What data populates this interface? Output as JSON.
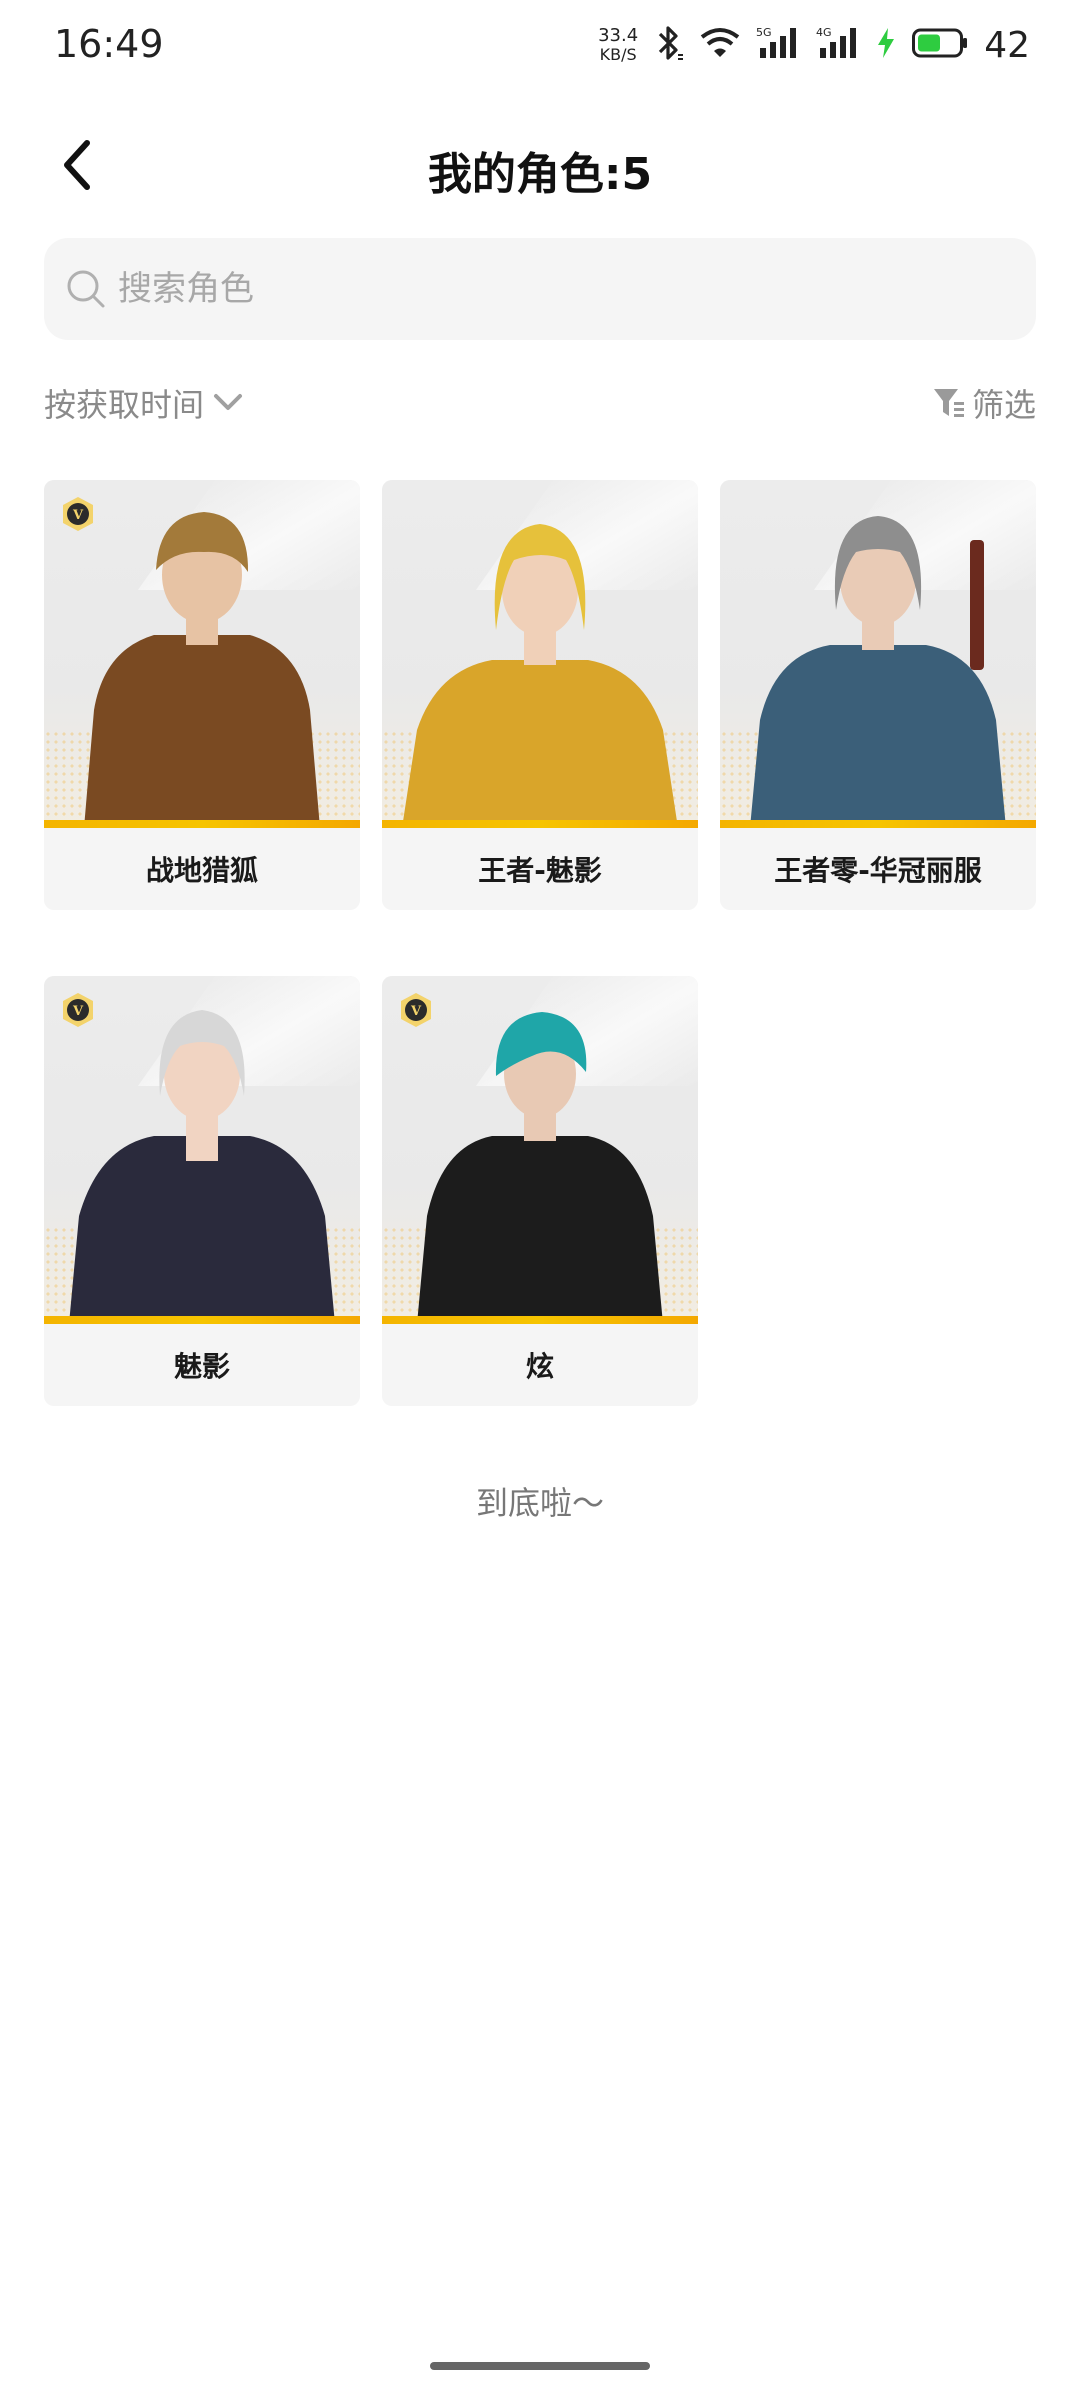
{
  "status_bar": {
    "time": "16:49",
    "net_speed_value": "33.4",
    "net_speed_unit": "KB/S",
    "signal_1_label": "5G",
    "signal_2_label": "4G",
    "battery_level": "42",
    "battery_color": "#2ecc40",
    "icons": [
      "bluetooth-icon",
      "wifi-icon",
      "signal-5g-icon",
      "signal-4g-icon",
      "charging-icon",
      "battery-icon"
    ]
  },
  "header": {
    "title": "我的角色:5",
    "back_icon": "chevron-left-icon"
  },
  "search": {
    "placeholder": "搜索角色",
    "value": "",
    "icon": "search-icon"
  },
  "toolbar": {
    "sort_label": "按获取时间",
    "sort_icon": "chevron-down-icon",
    "filter_label": "筛选",
    "filter_icon": "filter-icon"
  },
  "characters": [
    {
      "name": "战地猎狐",
      "vip": true,
      "hair": "#a37a3a",
      "outfit": "#7a4a22",
      "skin": "#e7c3a4"
    },
    {
      "name": "王者-魅影",
      "vip": false,
      "hair": "#e6c13b",
      "outfit": "#d9a52a",
      "skin": "#f0d0b8"
    },
    {
      "name": "王者零-华冠丽服",
      "vip": false,
      "hair": "#8e8e8e",
      "outfit": "#3b5f79",
      "skin": "#e9cbb6"
    },
    {
      "name": "魅影",
      "vip": true,
      "hair": "#d7d7d7",
      "outfit": "#2a2a3c",
      "skin": "#f1d4c2"
    },
    {
      "name": "炫",
      "vip": true,
      "hair": "#1fa6a8",
      "outfit": "#1c1c1c",
      "skin": "#e8c9b4"
    }
  ],
  "footer": {
    "end_text": "到底啦～"
  },
  "accent_bar_color": "#f4b400"
}
